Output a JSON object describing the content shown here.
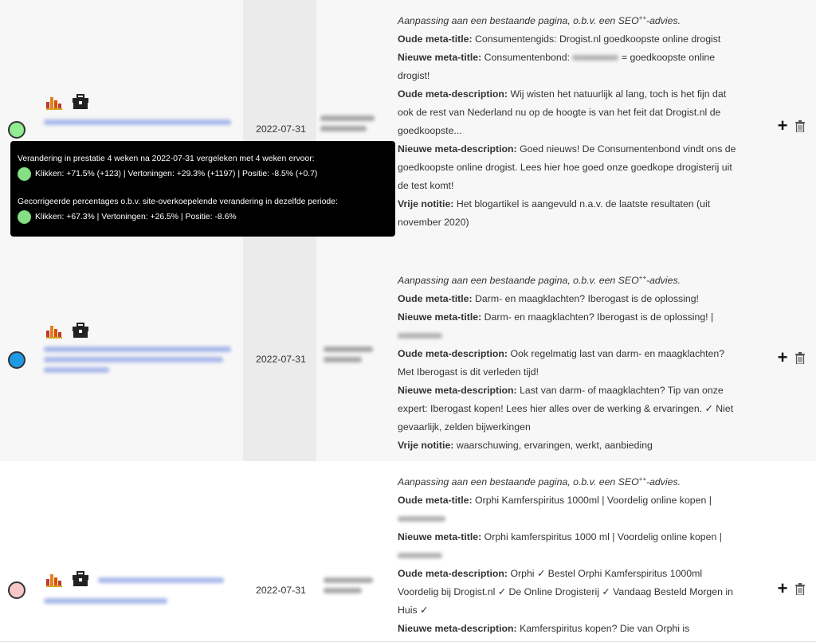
{
  "colors": {
    "green_dot": "#90ee90",
    "blue_dot": "#1e9be6",
    "pink_dot": "#f7c7c7"
  },
  "rows": [
    {
      "status_color": "#90ee90",
      "date": "2022-07-31",
      "intro_prefix": "Aanpassing aan een bestaande pagina, o.b.v. een SEO",
      "intro_sup": "++",
      "intro_suffix": "-advies.",
      "old_title_label": "Oude meta-title:",
      "old_title": "Consumentengids: Drogist.nl goedkoopste online drogist",
      "new_title_label": "Nieuwe meta-title:",
      "new_title_a": "Consumentenbond:",
      "new_title_b": "= goedkoopste online drogist!",
      "old_desc_label": "Oude meta-description:",
      "old_desc": "Wij wisten het natuurlijk al lang, toch is het fijn dat ook de rest van Nederland nu op de hoogte is van het feit dat Drogist.nl de goedkoopste...",
      "new_desc_label": "Nieuwe meta-description:",
      "new_desc": "Goed nieuws! De Consumentenbond vindt ons de goedkoopste online drogist. Lees hier hoe goed onze goedkope drogisterij uit de test komt!",
      "note_label": "Vrije notitie:",
      "note": "Het blogartikel is aangevuld n.a.v. de laatste resultaten (uit november 2020)"
    },
    {
      "status_color": "#1e9be6",
      "date": "2022-07-31",
      "intro_prefix": "Aanpassing aan een bestaande pagina, o.b.v. een SEO",
      "intro_sup": "++",
      "intro_suffix": "-advies.",
      "old_title_label": "Oude meta-title:",
      "old_title": "Darm- en maagklachten? Iberogast is de oplossing!",
      "new_title_label": "Nieuwe meta-title:",
      "new_title": "Darm- en maagklachten? Iberogast is de oplossing! |",
      "old_desc_label": "Oude meta-description:",
      "old_desc": "Ook regelmatig last van darm- en maagklachten? Met Iberogast is dit verleden tijd!",
      "new_desc_label": "Nieuwe meta-description:",
      "new_desc": "Last van darm- of maagklachten? Tip van onze expert: Iberogast kopen! Lees hier alles over de werking & ervaringen. ✓ Niet gevaarlijk, zelden bijwerkingen",
      "note_label": "Vrije notitie:",
      "note": "waarschuwing, ervaringen, werkt, aanbieding"
    },
    {
      "status_color": "#f7c7c7",
      "date": "2022-07-31",
      "intro_prefix": "Aanpassing aan een bestaande pagina, o.b.v. een SEO",
      "intro_sup": "++",
      "intro_suffix": "-advies.",
      "old_title_label": "Oude meta-title:",
      "old_title": "Orphi Kamferspiritus 1000ml | Voordelig online kopen |",
      "new_title_label": "Nieuwe meta-title:",
      "new_title": "Orphi kamferspiritus 1000 ml | Voordelig online kopen |",
      "old_desc_label": "Oude meta-description:",
      "old_desc": "Orphi ✓ Bestel Orphi Kamferspiritus 1000ml Voordelig bij Drogist.nl ✓ De Online Drogisterij ✓ Vandaag Besteld Morgen in Huis ✓",
      "new_desc_label": "Nieuwe meta-description:",
      "new_desc": "Kamferspiritus kopen? Die van Orphi is"
    }
  ],
  "tooltip": {
    "title1": "Verandering in prestatie 4 weken na 2022-07-31 vergeleken met 4 weken ervoor:",
    "stats1": "Klikken: +71.5% (+123) | Vertoningen: +29.3% (+1197) | Positie: -8.5% (+0.7)",
    "title2": "Gecorrigeerde percentages o.b.v. site-overkoepelende verandering in dezelfde periode:",
    "stats2": "Klikken: +67.3% | Vertoningen: +26.5% | Positie: -8.6%"
  },
  "icons": {
    "chart": "bar-chart-icon",
    "toolbox": "toolbox-icon",
    "add": "plus-icon",
    "delete": "trash-icon"
  },
  "actions": {
    "add_label": "+"
  }
}
